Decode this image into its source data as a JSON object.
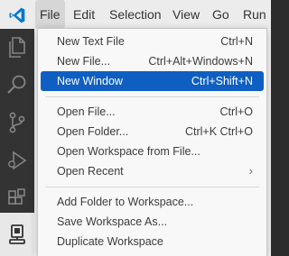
{
  "menubar": {
    "items": [
      {
        "label": "File"
      },
      {
        "label": "Edit"
      },
      {
        "label": "Selection"
      },
      {
        "label": "View"
      },
      {
        "label": "Go"
      },
      {
        "label": "Run"
      }
    ]
  },
  "file_menu": {
    "groups": [
      [
        {
          "label": "New Text File",
          "shortcut": "Ctrl+N"
        },
        {
          "label": "New File...",
          "shortcut": "Ctrl+Alt+Windows+N"
        },
        {
          "label": "New Window",
          "shortcut": "Ctrl+Shift+N",
          "highlighted": true
        }
      ],
      [
        {
          "label": "Open File...",
          "shortcut": "Ctrl+O"
        },
        {
          "label": "Open Folder...",
          "shortcut": "Ctrl+K Ctrl+O"
        },
        {
          "label": "Open Workspace from File...",
          "shortcut": ""
        },
        {
          "label": "Open Recent",
          "shortcut": "",
          "submenu": true
        }
      ],
      [
        {
          "label": "Add Folder to Workspace...",
          "shortcut": ""
        },
        {
          "label": "Save Workspace As...",
          "shortcut": ""
        },
        {
          "label": "Duplicate Workspace",
          "shortcut": ""
        }
      ]
    ]
  },
  "activitybar": {
    "icons": [
      "explorer-icon",
      "search-icon",
      "source-control-icon",
      "run-debug-icon",
      "extensions-icon",
      "remote-icon"
    ]
  },
  "colors": {
    "highlight": "#0f5fc2",
    "activitybar": "#333333",
    "vscode_blue": "#0078d4"
  },
  "submenu_arrow": "›"
}
